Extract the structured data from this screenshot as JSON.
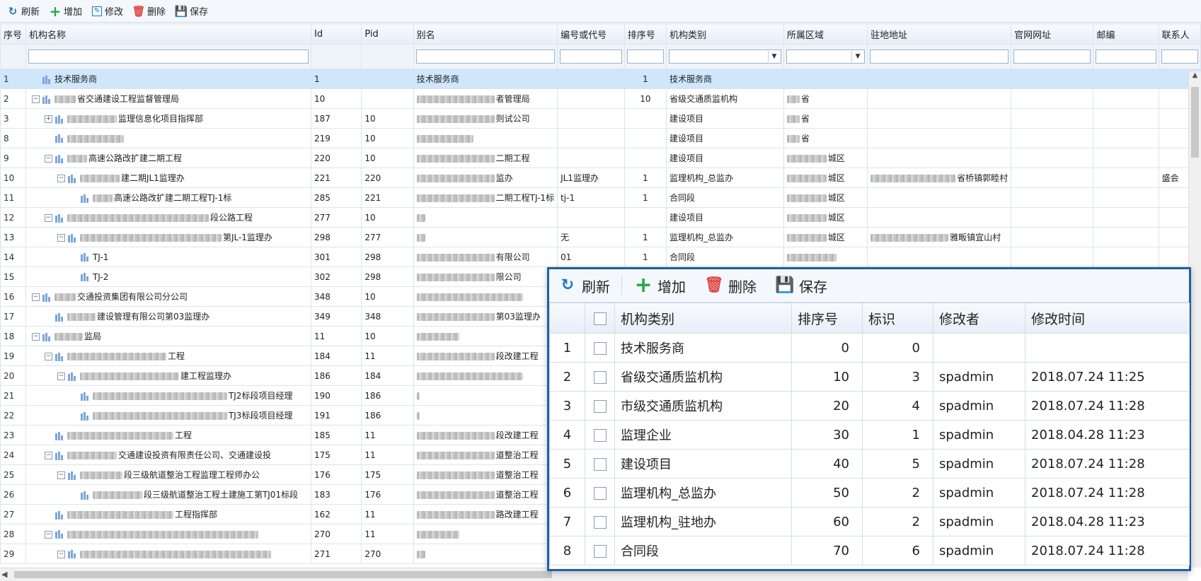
{
  "toolbar": {
    "refresh": "刷新",
    "add": "增加",
    "edit": "修改",
    "delete": "删除",
    "save": "保存"
  },
  "columns": [
    "序号",
    "机构名称",
    "Id",
    "Pid",
    "别名",
    "编号或代号",
    "排序号",
    "机构类别",
    "所属区域",
    "驻地地址",
    "官网网址",
    "邮编",
    "联系人"
  ],
  "rows": [
    {
      "no": "1",
      "level": 0,
      "toggle": "",
      "name": "技术服务商",
      "blurPre": 0,
      "id": "1",
      "pid": "",
      "alias": "技术服务商",
      "aliasBlur": 0,
      "code": "",
      "sort": "1",
      "cat": "技术服务商",
      "region": "",
      "regionBlur": 0,
      "addr": "",
      "addrBlur": 0,
      "contact": "",
      "selected": true
    },
    {
      "no": "2",
      "level": 0,
      "toggle": "−",
      "name": "省交通建设工程监督管理局",
      "blurPre": 30,
      "id": "10",
      "pid": "",
      "alias": "者管理局",
      "aliasBlur": 110,
      "code": "",
      "sort": "10",
      "cat": "省级交通质监机构",
      "region": "省",
      "regionBlur": 18,
      "addr": "",
      "addrBlur": 0,
      "contact": ""
    },
    {
      "no": "3",
      "level": 1,
      "toggle": "+",
      "name": "监理信息化项目指挥部",
      "blurPre": 70,
      "id": "187",
      "pid": "10",
      "alias": "则试公司",
      "aliasBlur": 110,
      "code": "",
      "sort": "",
      "cat": "建设项目",
      "region": "省",
      "regionBlur": 18,
      "addr": "",
      "addrBlur": 0,
      "contact": ""
    },
    {
      "no": "8",
      "level": 1,
      "toggle": "",
      "name": "",
      "blurPre": 80,
      "id": "219",
      "pid": "10",
      "alias": "",
      "aliasBlur": 80,
      "code": "",
      "sort": "",
      "cat": "建设项目",
      "region": "省",
      "regionBlur": 18,
      "addr": "",
      "addrBlur": 0,
      "contact": ""
    },
    {
      "no": "9",
      "level": 1,
      "toggle": "−",
      "name": "高速公路改扩建二期工程",
      "blurPre": 28,
      "id": "220",
      "pid": "10",
      "alias": "二期工程",
      "aliasBlur": 110,
      "code": "",
      "sort": "",
      "cat": "建设项目",
      "region": "城区",
      "regionBlur": 56,
      "addr": "",
      "addrBlur": 0,
      "contact": ""
    },
    {
      "no": "10",
      "level": 2,
      "toggle": "−",
      "name": "建二期JL1监理办",
      "blurPre": 56,
      "id": "221",
      "pid": "220",
      "alias": "监办",
      "aliasBlur": 110,
      "code": "JL1监理办",
      "sort": "1",
      "cat": "监理机构_总监办",
      "region": "城区",
      "regionBlur": 56,
      "addr": "省桥镇郭睦村",
      "addrBlur": 120,
      "contact": "盛会"
    },
    {
      "no": "11",
      "level": 3,
      "toggle": "",
      "name": "高速公路改扩建二期工程TJ-1标",
      "blurPre": 28,
      "id": "285",
      "pid": "221",
      "alias": "二期工程TJ-1标",
      "aliasBlur": 110,
      "code": "tj-1",
      "sort": "1",
      "cat": "合同段",
      "region": "城区",
      "regionBlur": 56,
      "addr": "",
      "addrBlur": 0,
      "contact": ""
    },
    {
      "no": "12",
      "level": 1,
      "toggle": "−",
      "name": "段公路工程",
      "blurPre": 200,
      "id": "277",
      "pid": "10",
      "alias": "",
      "aliasBlur": 12,
      "code": "",
      "sort": "",
      "cat": "建设项目",
      "region": "城区",
      "regionBlur": 56,
      "addr": "",
      "addrBlur": 0,
      "contact": ""
    },
    {
      "no": "13",
      "level": 2,
      "toggle": "−",
      "name": "第JL-1监理办",
      "blurPre": 200,
      "id": "298",
      "pid": "277",
      "alias": "",
      "aliasBlur": 12,
      "code": "无",
      "sort": "1",
      "cat": "监理机构_总监办",
      "region": "城区",
      "regionBlur": 56,
      "addr": "雅畈镇宜山村",
      "addrBlur": 110,
      "contact": ""
    },
    {
      "no": "14",
      "level": 3,
      "toggle": "",
      "name": "TJ-1",
      "blurPre": 0,
      "id": "301",
      "pid": "298",
      "alias": "有限公司",
      "aliasBlur": 110,
      "code": "01",
      "sort": "1",
      "cat": "合同段",
      "region": "",
      "regionBlur": 70,
      "addr": "",
      "addrBlur": 0,
      "contact": ""
    },
    {
      "no": "15",
      "level": 3,
      "toggle": "",
      "name": "TJ-2",
      "blurPre": 0,
      "id": "302",
      "pid": "298",
      "alias": "限公司",
      "aliasBlur": 110,
      "code": "",
      "sort": "",
      "cat": "",
      "region": "",
      "regionBlur": 0,
      "addr": "",
      "addrBlur": 0,
      "contact": ""
    },
    {
      "no": "16",
      "level": 0,
      "toggle": "−",
      "name": "交通投资集团有限公司分公司",
      "blurPre": 30,
      "id": "348",
      "pid": "10",
      "alias": "",
      "aliasBlur": 150,
      "code": "",
      "sort": "",
      "cat": "",
      "region": "",
      "regionBlur": 0,
      "addr": "",
      "addrBlur": 0,
      "contact": ""
    },
    {
      "no": "17",
      "level": 1,
      "toggle": "",
      "name": "建设管理有限公司第03监理办",
      "blurPre": 40,
      "id": "349",
      "pid": "348",
      "alias": "第03监理办",
      "aliasBlur": 110,
      "code": "",
      "sort": "",
      "cat": "",
      "region": "",
      "regionBlur": 0,
      "addr": "",
      "addrBlur": 0,
      "contact": ""
    },
    {
      "no": "18",
      "level": 0,
      "toggle": "−",
      "name": "监局",
      "blurPre": 40,
      "id": "11",
      "pid": "10",
      "alias": "",
      "aliasBlur": 60,
      "code": "",
      "sort": "",
      "cat": "",
      "region": "",
      "regionBlur": 0,
      "addr": "",
      "addrBlur": 0,
      "contact": ""
    },
    {
      "no": "19",
      "level": 1,
      "toggle": "−",
      "name": "工程",
      "blurPre": 140,
      "id": "184",
      "pid": "11",
      "alias": "段改建工程",
      "aliasBlur": 110,
      "code": "",
      "sort": "",
      "cat": "",
      "region": "",
      "regionBlur": 0,
      "addr": "",
      "addrBlur": 0,
      "contact": ""
    },
    {
      "no": "20",
      "level": 2,
      "toggle": "−",
      "name": "建工程监理办",
      "blurPre": 140,
      "id": "186",
      "pid": "184",
      "alias": "",
      "aliasBlur": 150,
      "code": "",
      "sort": "",
      "cat": "",
      "region": "",
      "regionBlur": 0,
      "addr": "",
      "addrBlur": 0,
      "contact": ""
    },
    {
      "no": "21",
      "level": 3,
      "toggle": "",
      "name": "TJ2标段项目经理",
      "blurPre": 190,
      "id": "190",
      "pid": "186",
      "alias": "",
      "aliasBlur": 4,
      "code": "",
      "sort": "",
      "cat": "",
      "region": "",
      "regionBlur": 0,
      "addr": "",
      "addrBlur": 0,
      "contact": ""
    },
    {
      "no": "22",
      "level": 3,
      "toggle": "",
      "name": "TJ3标段项目经理",
      "blurPre": 190,
      "id": "191",
      "pid": "186",
      "alias": "",
      "aliasBlur": 4,
      "code": "",
      "sort": "",
      "cat": "",
      "region": "",
      "regionBlur": 0,
      "addr": "",
      "addrBlur": 0,
      "contact": ""
    },
    {
      "no": "23",
      "level": 1,
      "toggle": "",
      "name": "工程",
      "blurPre": 150,
      "id": "185",
      "pid": "11",
      "alias": "段改建工程",
      "aliasBlur": 110,
      "code": "",
      "sort": "",
      "cat": "",
      "region": "",
      "regionBlur": 0,
      "addr": "",
      "addrBlur": 0,
      "contact": ""
    },
    {
      "no": "24",
      "level": 1,
      "toggle": "−",
      "name": "交通建设投资有限责任公司、交通建设投",
      "blurPre": 70,
      "id": "175",
      "pid": "11",
      "alias": "道整治工程",
      "aliasBlur": 110,
      "code": "",
      "sort": "",
      "cat": "",
      "region": "",
      "regionBlur": 0,
      "addr": "",
      "addrBlur": 0,
      "contact": ""
    },
    {
      "no": "25",
      "level": 2,
      "toggle": "−",
      "name": "段三级航道整治工程监理工程师办公",
      "blurPre": 60,
      "id": "176",
      "pid": "175",
      "alias": "道整治工程",
      "aliasBlur": 110,
      "code": "",
      "sort": "",
      "cat": "",
      "region": "",
      "regionBlur": 0,
      "addr": "",
      "addrBlur": 0,
      "contact": ""
    },
    {
      "no": "26",
      "level": 3,
      "toggle": "",
      "name": "段三级航道整治工程土建施工第TJ01标段",
      "blurPre": 70,
      "id": "183",
      "pid": "176",
      "alias": "道整治工程",
      "aliasBlur": 110,
      "code": "",
      "sort": "",
      "cat": "",
      "region": "",
      "regionBlur": 0,
      "addr": "",
      "addrBlur": 0,
      "contact": ""
    },
    {
      "no": "27",
      "level": 1,
      "toggle": "",
      "name": "工程指挥部",
      "blurPre": 150,
      "id": "162",
      "pid": "11",
      "alias": "路改建工程",
      "aliasBlur": 110,
      "code": "",
      "sort": "",
      "cat": "",
      "region": "",
      "regionBlur": 0,
      "addr": "",
      "addrBlur": 0,
      "contact": ""
    },
    {
      "no": "28",
      "level": 1,
      "toggle": "−",
      "name": "",
      "blurPre": 270,
      "id": "270",
      "pid": "11",
      "alias": "",
      "aliasBlur": 60,
      "code": "",
      "sort": "",
      "cat": "",
      "region": "",
      "regionBlur": 0,
      "addr": "",
      "addrBlur": 0,
      "contact": ""
    },
    {
      "no": "29",
      "level": 2,
      "toggle": "−",
      "name": "",
      "blurPre": 270,
      "id": "271",
      "pid": "270",
      "alias": "",
      "aliasBlur": 12,
      "code": "",
      "sort": "",
      "cat": "",
      "region": "",
      "regionBlur": 0,
      "addr": "",
      "addrBlur": 0,
      "contact": ""
    }
  ],
  "popup": {
    "toolbar": {
      "refresh": "刷新",
      "add": "增加",
      "delete": "删除",
      "save": "保存"
    },
    "columns": [
      "",
      "",
      "机构类别",
      "排序号",
      "标识",
      "修改者",
      "修改时间"
    ],
    "rows": [
      {
        "no": "1",
        "cat": "技术服务商",
        "sort": "0",
        "flag": "0",
        "modifier": "",
        "time": ""
      },
      {
        "no": "2",
        "cat": "省级交通质监机构",
        "sort": "10",
        "flag": "3",
        "modifier": "spadmin",
        "time": "2018.07.24 11:25"
      },
      {
        "no": "3",
        "cat": "市级交通质监机构",
        "sort": "20",
        "flag": "4",
        "modifier": "spadmin",
        "time": "2018.07.24 11:28"
      },
      {
        "no": "4",
        "cat": "监理企业",
        "sort": "30",
        "flag": "1",
        "modifier": "spadmin",
        "time": "2018.04.28 11:23"
      },
      {
        "no": "5",
        "cat": "建设项目",
        "sort": "40",
        "flag": "5",
        "modifier": "spadmin",
        "time": "2018.07.24 11:28"
      },
      {
        "no": "6",
        "cat": "监理机构_总监办",
        "sort": "50",
        "flag": "2",
        "modifier": "spadmin",
        "time": "2018.07.24 11:28"
      },
      {
        "no": "7",
        "cat": "监理机构_驻地办",
        "sort": "60",
        "flag": "2",
        "modifier": "spadmin",
        "time": "2018.04.28 11:23"
      },
      {
        "no": "8",
        "cat": "合同段",
        "sort": "70",
        "flag": "6",
        "modifier": "spadmin",
        "time": "2018.07.24 11:28"
      }
    ]
  },
  "colors": {
    "accent": "#1a78c8",
    "selected_row": "#cfe6fb",
    "popup_border": "#1f5fa6",
    "delete": "#e04848",
    "add": "#28a745"
  }
}
